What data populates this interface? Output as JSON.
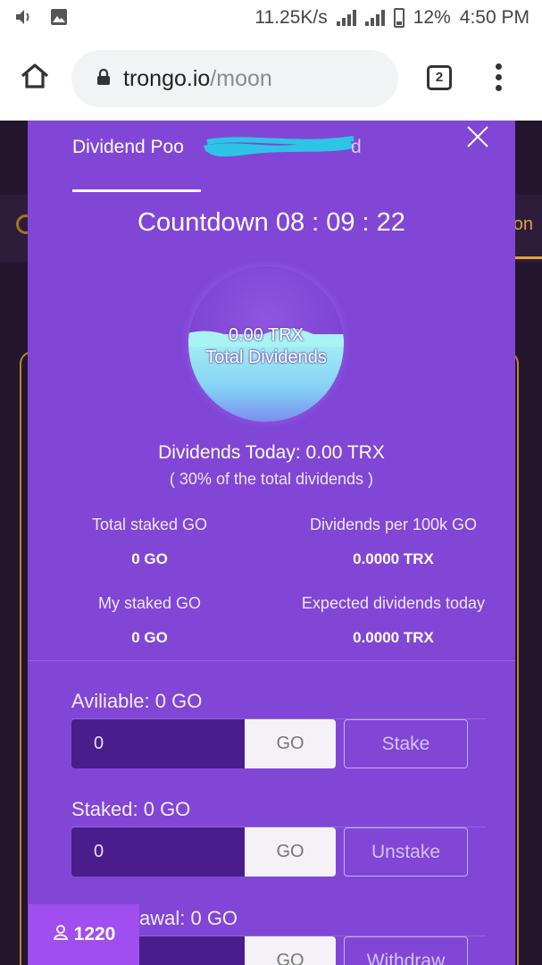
{
  "status_bar": {
    "net_speed": "11.25K/s",
    "battery": "12%",
    "time": "4:50 PM"
  },
  "browser": {
    "url_host": "trongo.io",
    "url_path": "/moon",
    "tab_count": "2"
  },
  "page": {
    "partial_tab_label": "on"
  },
  "modal": {
    "tabs": [
      {
        "label": "Dividend Poo",
        "active": true
      },
      {
        "label": "d",
        "active": false
      }
    ],
    "countdown_label": "Countdown 08 : 09 : 22",
    "orb": {
      "value": "0.00 TRX",
      "label": "Total Dividends",
      "fill_fraction": 0.45
    },
    "dividends_today": "Dividends Today: 0.00 TRX",
    "dividends_note": "( 30% of the total dividends )",
    "stats": [
      {
        "label": "Total staked GO",
        "value": "0 GO"
      },
      {
        "label": "Dividends per 100k GO",
        "value": "0.0000 TRX"
      },
      {
        "label": "My staked GO",
        "value": "0 GO"
      },
      {
        "label": "Expected dividends today",
        "value": "0.0000 TRX"
      }
    ],
    "rows": [
      {
        "label": "Aviliable: 0 GO",
        "amount": "0",
        "unit": "GO",
        "action": "Stake"
      },
      {
        "label": "Staked: 0 GO",
        "amount": "0",
        "unit": "GO",
        "action": "Unstake"
      },
      {
        "label": "awal: 0 GO",
        "amount": "",
        "unit": "GO",
        "action": "Withdraw"
      }
    ]
  },
  "online_chip": {
    "count": "1220"
  },
  "colors": {
    "modal_bg": "#8146d6",
    "page_bg": "#24162e",
    "accent_gold": "#e0a23a",
    "input_bg": "#4a1d8c",
    "chip_bg": "#a04ef0"
  }
}
